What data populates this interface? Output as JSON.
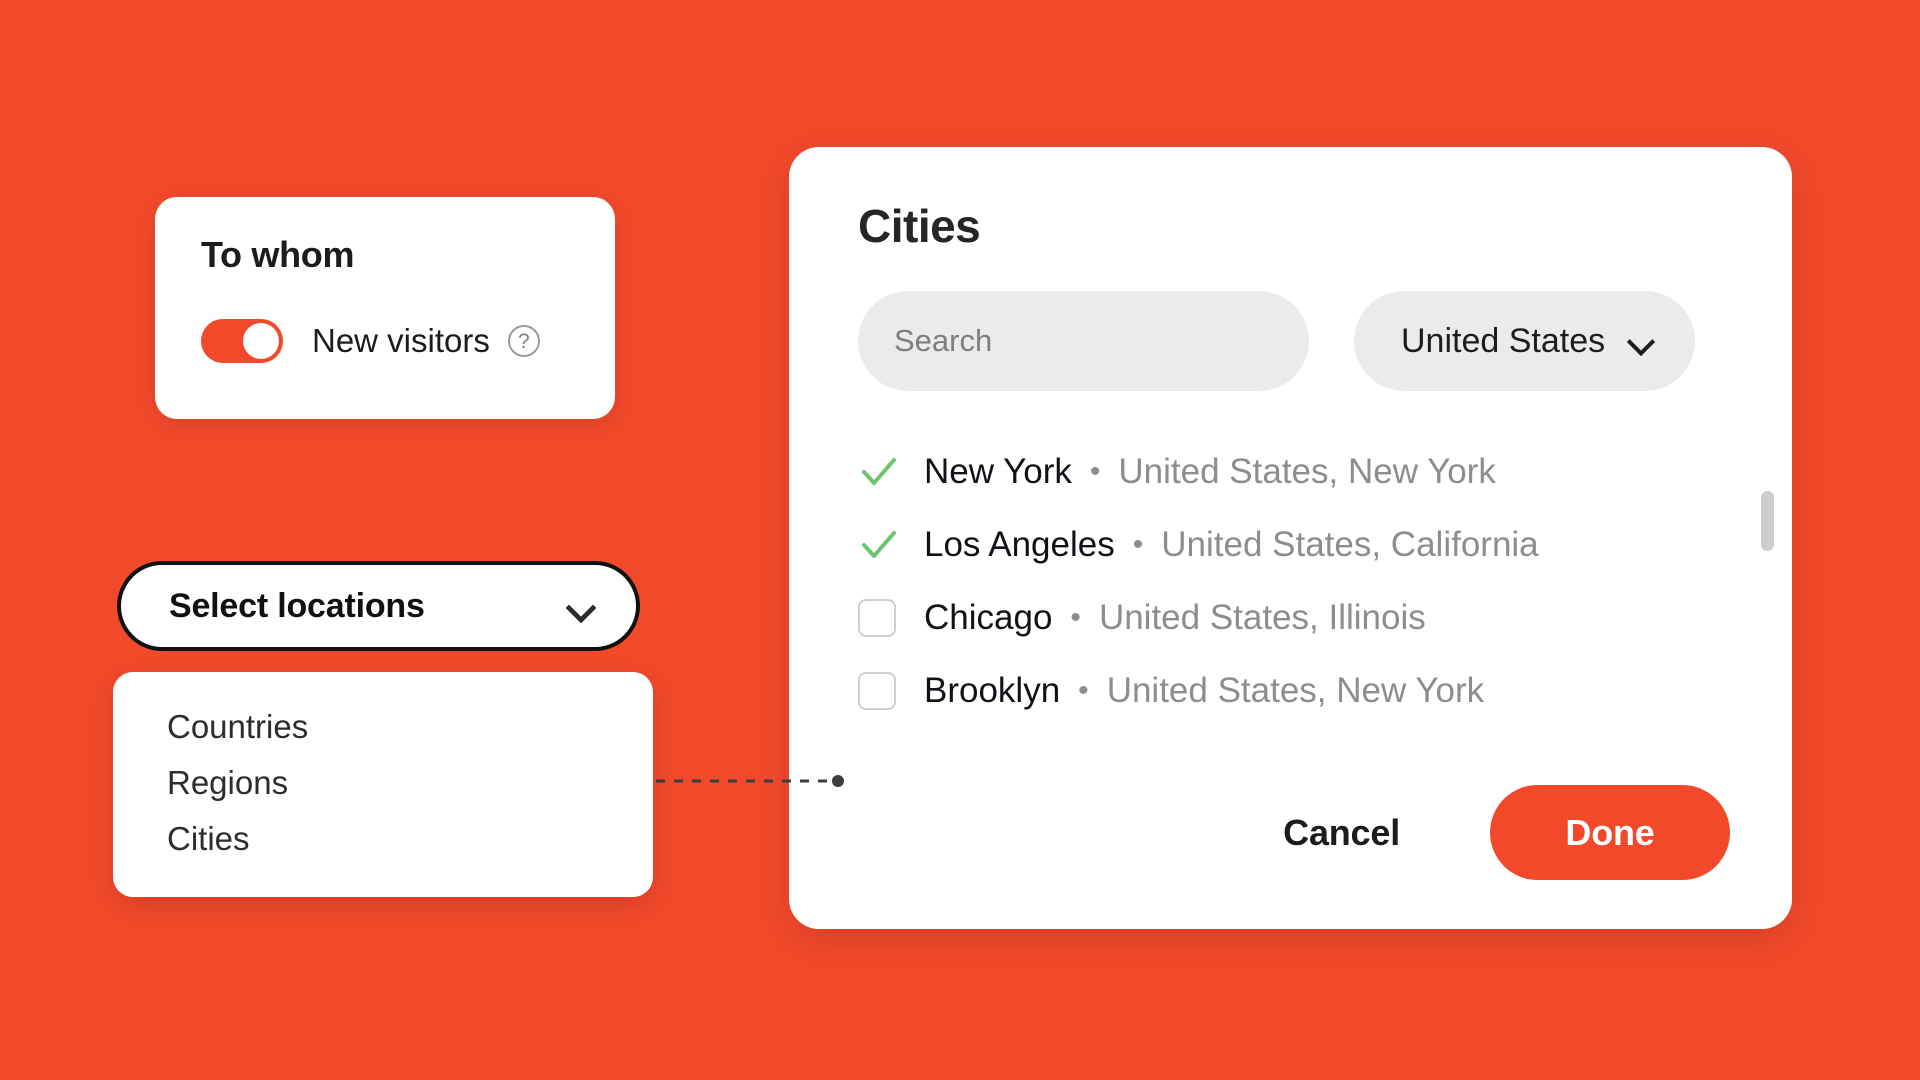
{
  "theme": {
    "background": "#F2492B",
    "accent": "#F2492B",
    "check_green": "#6FC46F",
    "muted_text": "#8D8D8D",
    "field_bg": "#EBEBEB"
  },
  "to_whom_card": {
    "title": "To whom",
    "toggle": {
      "label": "New visitors",
      "state": "on",
      "help_icon": "question-circle-icon"
    }
  },
  "select_locations": {
    "label": "Select locations",
    "chevron_icon": "chevron-down-icon",
    "menu_items": [
      {
        "label": "Countries"
      },
      {
        "label": "Regions"
      },
      {
        "label": "Cities"
      }
    ]
  },
  "modal": {
    "title": "Cities",
    "search": {
      "value": "",
      "placeholder": "Search",
      "icon": "search-icon"
    },
    "country_select": {
      "value": "United States",
      "chevron_icon": "chevron-down-icon"
    },
    "cities": [
      {
        "name": "New York",
        "separator": "•",
        "region": "United States, New York",
        "checked": true,
        "icon": "check-icon"
      },
      {
        "name": "Los Angeles",
        "separator": "•",
        "region": "United States, California",
        "checked": true,
        "icon": "check-icon"
      },
      {
        "name": "Chicago",
        "separator": "•",
        "region": "United States, Illinois",
        "checked": false,
        "icon": "checkbox-empty-icon"
      },
      {
        "name": "Brooklyn",
        "separator": "•",
        "region": "United States, New York",
        "checked": false,
        "icon": "checkbox-empty-icon"
      }
    ],
    "footer": {
      "cancel_label": "Cancel",
      "done_label": "Done"
    }
  }
}
